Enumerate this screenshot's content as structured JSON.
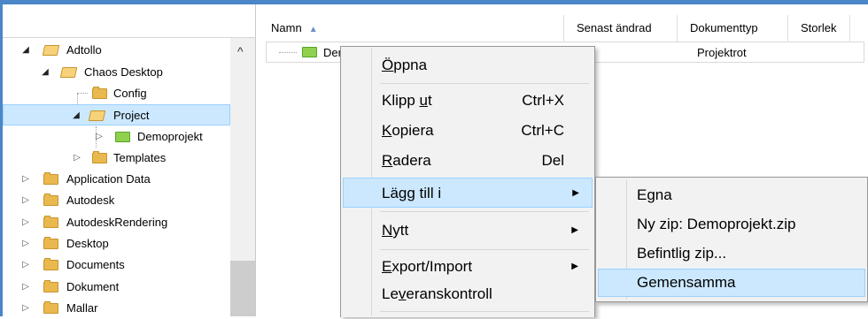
{
  "tree": {
    "items": [
      {
        "label": "Adtollo",
        "expander": "open",
        "folder": "open"
      },
      {
        "label": "Chaos Desktop",
        "expander": "open",
        "folder": "open"
      },
      {
        "label": "Config",
        "expander": "none",
        "folder": "closed"
      },
      {
        "label": "Project",
        "expander": "open",
        "folder": "open",
        "selected": true
      },
      {
        "label": "Demoprojekt",
        "expander": "closed",
        "folder": "green"
      },
      {
        "label": "Templates",
        "expander": "closed",
        "folder": "closed"
      },
      {
        "label": "Application Data",
        "expander": "closed",
        "folder": "closed"
      },
      {
        "label": "Autodesk",
        "expander": "closed",
        "folder": "closed"
      },
      {
        "label": "AutodeskRendering",
        "expander": "closed",
        "folder": "closed"
      },
      {
        "label": "Desktop",
        "expander": "closed",
        "folder": "closed"
      },
      {
        "label": "Documents",
        "expander": "closed",
        "folder": "closed"
      },
      {
        "label": "Dokument",
        "expander": "closed",
        "folder": "closed"
      },
      {
        "label": "Mallar",
        "expander": "closed",
        "folder": "closed"
      }
    ]
  },
  "list": {
    "columns": [
      "Namn",
      "Senast ändrad",
      "Dokumenttyp",
      "Storlek"
    ],
    "rows": [
      {
        "name": "Demoprojekt",
        "type": "Projektrot"
      }
    ]
  },
  "context_menu": {
    "items": [
      {
        "pre": "",
        "u": "Ö",
        "post": "ppna",
        "shortcut": ""
      },
      {
        "pre": "Klipp ",
        "u": "u",
        "post": "t",
        "shortcut": "Ctrl+X"
      },
      {
        "pre": "",
        "u": "K",
        "post": "opiera",
        "shortcut": "Ctrl+C"
      },
      {
        "pre": "",
        "u": "R",
        "post": "adera",
        "shortcut": "Del"
      },
      {
        "pre": "Lägg till i",
        "u": "",
        "post": "",
        "shortcut": "",
        "submenu": true
      },
      {
        "pre": "",
        "u": "N",
        "post": "ytt",
        "shortcut": "",
        "submenu": true
      },
      {
        "pre": "",
        "u": "E",
        "post": "xport/Import",
        "shortcut": "",
        "submenu": true
      },
      {
        "pre": "Le",
        "u": "v",
        "post": "eranskontroll",
        "shortcut": ""
      }
    ]
  },
  "submenu": {
    "items": [
      "Egna",
      "Ny zip: Demoprojekt.zip",
      "Befintlig zip...",
      "Gemensamma"
    ]
  },
  "colors": {
    "selection": "#cce8ff",
    "selection_border": "#99d1ff",
    "folder": "#e9b84f",
    "project_folder": "#8fd14f"
  }
}
